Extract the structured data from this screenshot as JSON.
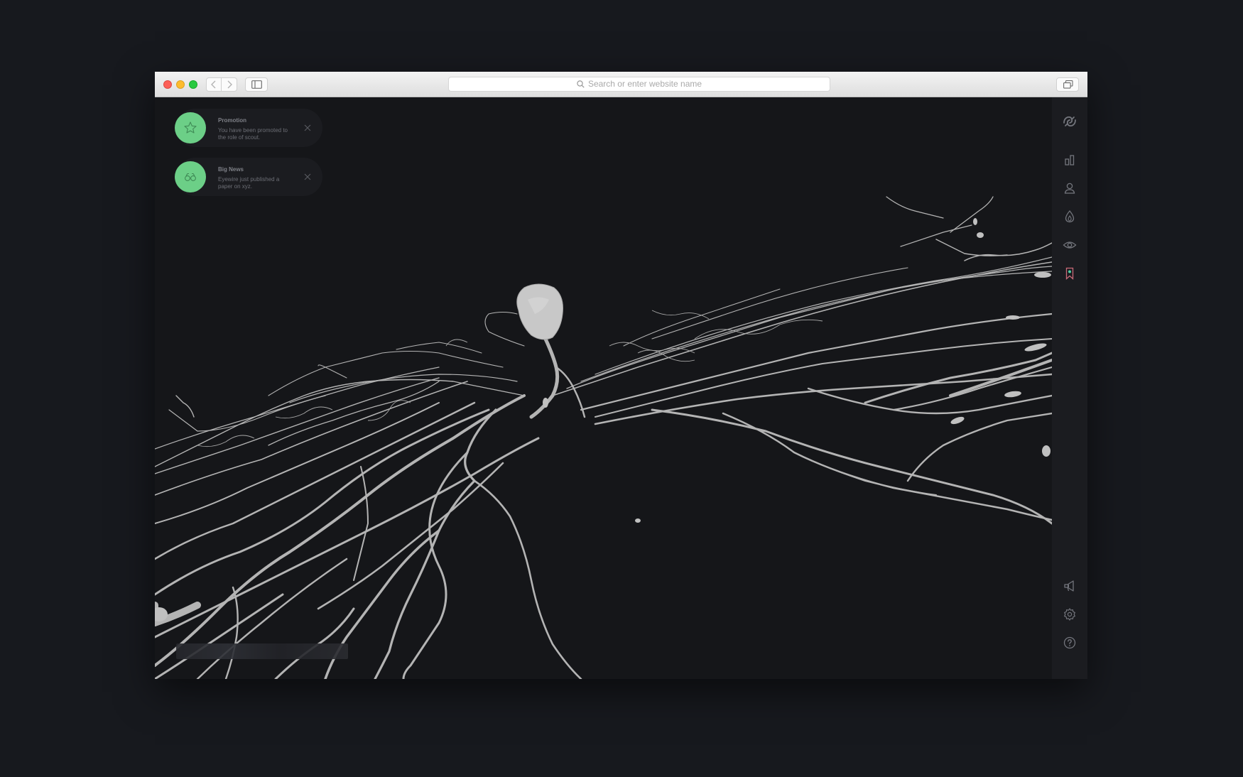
{
  "browser": {
    "address_placeholder": "Search or enter website name",
    "traffic_colors": {
      "close": "#fc5f57",
      "minimize": "#fdbc2e",
      "maximize": "#29c940"
    },
    "icons": [
      "back-chevron-icon",
      "forward-chevron-icon",
      "sidebar-icon",
      "search-icon",
      "tabs-overview-icon"
    ]
  },
  "notifications": [
    {
      "title": "Promotion",
      "body": "You have been promoted to the role of scout.",
      "icon": "star-icon",
      "badge_color": "#6ccf87"
    },
    {
      "title": "Big News",
      "body": "Eyewire just published a paper on xyz.",
      "icon": "binoculars-icon",
      "badge_color": "#6ccf87"
    }
  ],
  "rail": {
    "top_icons": [
      "logo-icon",
      "stats-icon",
      "profile-icon",
      "flame-icon",
      "eye-icon",
      "bookmark-icon"
    ],
    "bottom_icons": [
      "megaphone-icon",
      "settings-icon",
      "help-icon"
    ],
    "accent": "#4fd1a7"
  },
  "scene": {
    "subject": "3D neuron reconstruction",
    "neuron_color": "#b8b8b8",
    "background": "#151619"
  }
}
